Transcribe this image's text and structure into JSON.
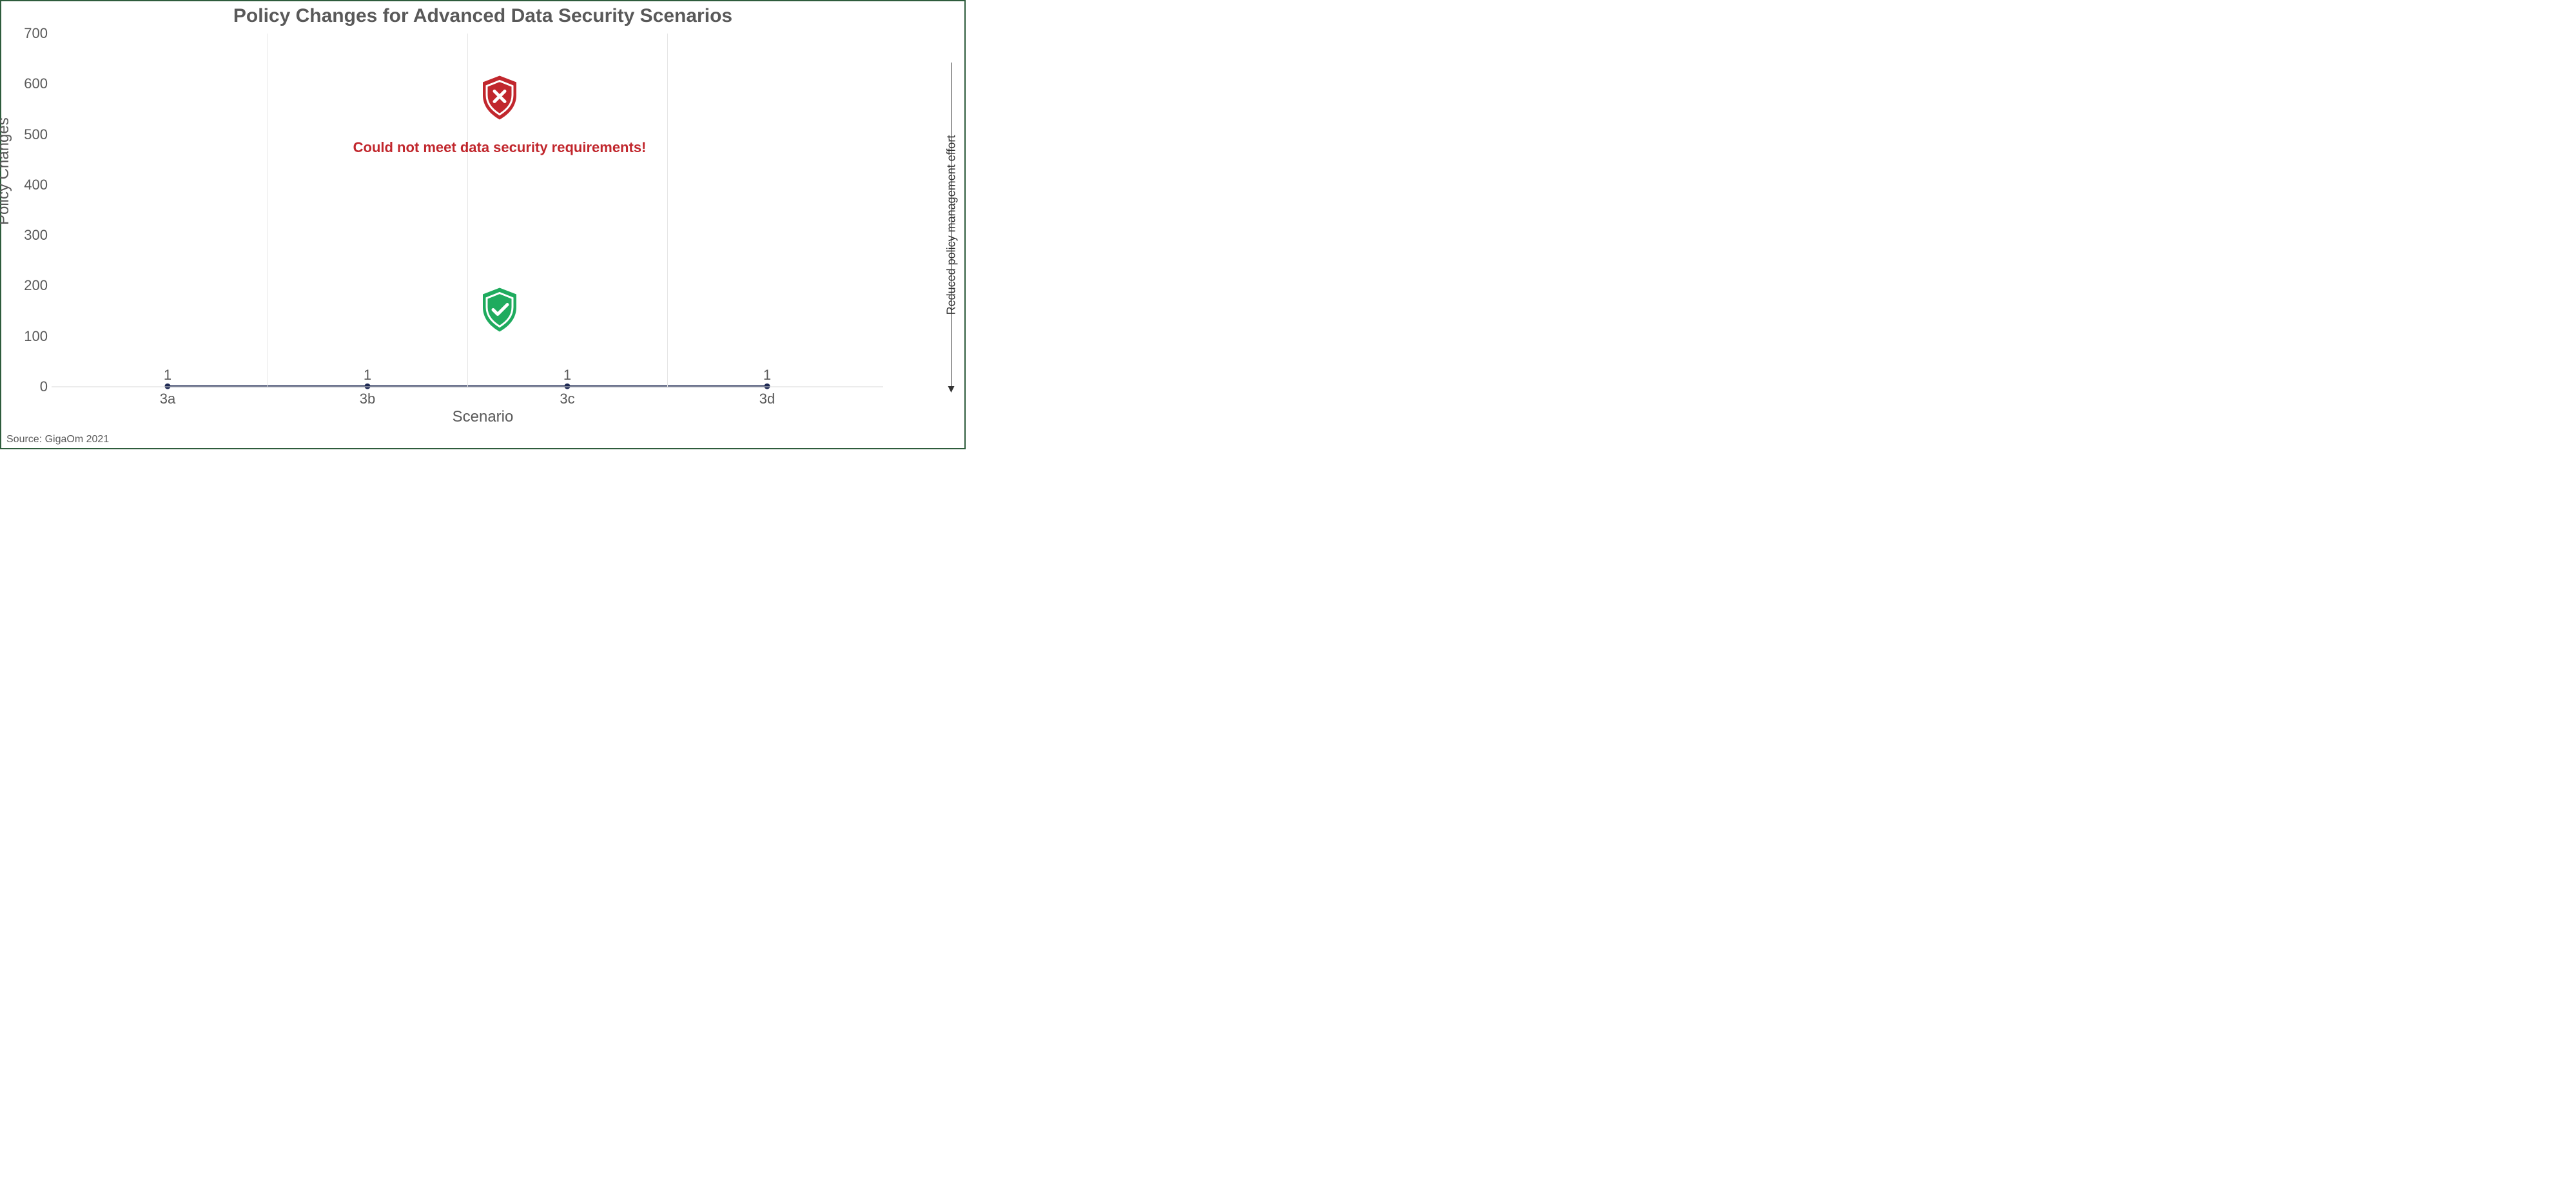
{
  "chart_data": {
    "type": "line",
    "title": "Policy Changes for Advanced Data Security Scenarios",
    "xlabel": "Scenario",
    "ylabel": "Policy Changes",
    "categories": [
      "3a",
      "3b",
      "3c",
      "3d"
    ],
    "values": [
      1,
      1,
      1,
      1
    ],
    "ylim": [
      0,
      700
    ],
    "yticks": [
      0,
      100,
      200,
      300,
      400,
      500,
      600,
      700
    ],
    "annotation": "Could not meet data security requirements!",
    "right_axis_label": "Reduced policy management effort",
    "source": "Source: GigaOm 2021",
    "series_color": "#1f2a54"
  }
}
